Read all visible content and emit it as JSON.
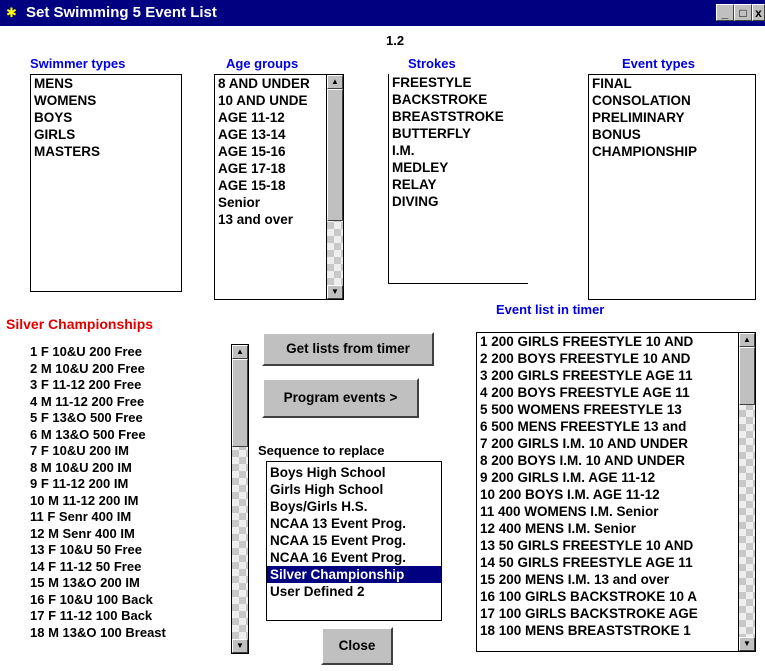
{
  "window": {
    "title": "Set Swimming 5 Event List",
    "version": "1.2"
  },
  "titlebar_buttons": {
    "minimize": "_",
    "maximize": "□",
    "close": "x"
  },
  "swimmer_types": {
    "header": "Swimmer types",
    "items": [
      "MENS",
      "WOMENS",
      "BOYS",
      "GIRLS",
      "MASTERS"
    ]
  },
  "age_groups": {
    "header": "Age groups",
    "items": [
      "8 AND UNDER",
      "10 AND UNDE",
      "AGE 11-12",
      "AGE 13-14",
      "AGE 15-16",
      "AGE 17-18",
      "AGE 15-18",
      "Senior",
      "13 and over"
    ]
  },
  "strokes": {
    "header": "Strokes",
    "items": [
      "FREESTYLE",
      "BACKSTROKE",
      "BREASTSTROKE",
      "BUTTERFLY",
      "I.M.",
      "MEDLEY",
      "RELAY",
      "DIVING"
    ]
  },
  "event_types": {
    "header": "Event types",
    "items": [
      "FINAL",
      "CONSOLATION",
      "PRELIMINARY",
      "BONUS",
      "CHAMPIONSHIP"
    ]
  },
  "selected_sequence": {
    "title": "Silver Championships",
    "items": [
      "1 F 10&U 200 Free",
      "2 M 10&U 200 Free",
      "3 F 11-12 200 Free",
      "4 M 11-12 200 Free",
      "5 F 13&O 500 Free",
      "6 M 13&O 500 Free",
      "7 F 10&U 200 IM",
      "8 M 10&U 200 IM",
      "9 F 11-12 200 IM",
      "10 M 11-12 200 IM",
      "11 F Senr 400 IM",
      "12 M Senr 400 IM",
      "13 F 10&U 50 Free",
      "14 F 11-12 50 Free",
      "15 M 13&O 200 IM",
      "16 F 10&U 100 Back",
      "17 F 11-12 100 Back",
      "18 M 13&O 100 Breast"
    ]
  },
  "buttons": {
    "get_lists": "Get lists from timer",
    "program_events": "Program events  >",
    "close": "Close"
  },
  "sequence_to_replace": {
    "label": "Sequence to replace",
    "items": [
      "Boys High School",
      "Girls High School",
      "Boys/Girls H.S.",
      "NCAA 13 Event Prog.",
      "NCAA 15 Event Prog.",
      "NCAA 16 Event Prog.",
      "Silver Championship",
      "User Defined 2"
    ],
    "selected": "Silver Championship"
  },
  "event_list": {
    "header": "Event list in timer",
    "items": [
      "1 200 GIRLS FREESTYLE 10 AND",
      "2 200 BOYS FREESTYLE 10 AND",
      "3 200 GIRLS FREESTYLE AGE 11",
      "4 200 BOYS FREESTYLE AGE 11",
      "5 500 WOMENS FREESTYLE 13",
      "6 500 MENS FREESTYLE 13 and",
      "7 200 GIRLS I.M. 10 AND UNDER",
      "8 200 BOYS I.M. 10 AND UNDER",
      "9 200 GIRLS I.M. AGE 11-12",
      "10 200 BOYS I.M. AGE 11-12",
      "11 400 WOMENS I.M. Senior",
      "12 400 MENS I.M. Senior",
      "13 50 GIRLS FREESTYLE 10 AND",
      "14 50 GIRLS FREESTYLE AGE 11",
      "15 200 MENS I.M. 13 and over",
      "16 100 GIRLS BACKSTROKE 10 A",
      "17 100 GIRLS BACKSTROKE AGE",
      "18 100 MENS BREASTSTROKE 1"
    ]
  },
  "colors": {
    "titlebar": "#000080",
    "header_blue": "#0000e0",
    "title_red": "#e00000",
    "selection": "#000080"
  }
}
